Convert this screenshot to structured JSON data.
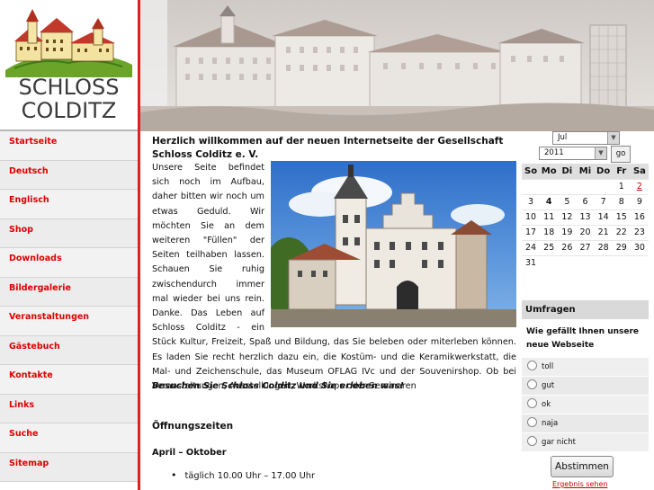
{
  "logo": {
    "line1": "SCHLOSS",
    "line2": "COLDITZ"
  },
  "nav": {
    "items": [
      {
        "label": "Startseite"
      },
      {
        "label": "Deutsch"
      },
      {
        "label": "Englisch"
      },
      {
        "label": "Shop"
      },
      {
        "label": "Downloads"
      },
      {
        "label": "Bildergalerie"
      },
      {
        "label": "Veranstaltungen"
      },
      {
        "label": "Gästebuch"
      },
      {
        "label": "Kontakte"
      },
      {
        "label": "Links"
      },
      {
        "label": "Suche"
      },
      {
        "label": "Sitemap"
      }
    ]
  },
  "main": {
    "welcome": "Herzlich willkommen auf der neuen Internetseite der Gesellschaft Schloss Colditz e. V.",
    "intro": "Unsere Seite befindet sich noch im Aufbau, daher bitten wir noch um etwas Geduld. Wir möchten Sie an dem weiteren \"Füllen\" der Seiten teilhaben lassen. Schauen Sie ruhig zwischendurch immer mal wieder bei uns rein. Danke. Das Leben auf Schloss Colditz - ein Stück Kultur, Freizeit, Spaß und Bildung, das Sie beleben oder miterleben können. Es laden Sie recht herzlich dazu ein, die Kostüm- und die Keramikwerkstatt, die Mal- und Zeichenschule, das Museum OFLAG IVc und der Souvenirshop. Ob bei Veranstaltungen, Ausstellungen, Workshops oder Seminaren",
    "tagline": "Besuchen Sie Schloss Colditz und Sie erleben was!",
    "hours_title": "Öffnungszeiten",
    "season": "April – Oktober",
    "hours": [
      "täglich 10.00 Uhr – 17.00 Uhr"
    ]
  },
  "calendar": {
    "month": "Jul",
    "year": "2011",
    "go_label": "go",
    "weekdays": [
      "So",
      "Mo",
      "Di",
      "Mi",
      "Do",
      "Fr",
      "Sa"
    ],
    "weeks": [
      [
        "",
        "",
        "",
        "",
        "",
        "1",
        "2"
      ],
      [
        "3",
        "4",
        "5",
        "6",
        "7",
        "8",
        "9"
      ],
      [
        "10",
        "11",
        "12",
        "13",
        "14",
        "15",
        "16"
      ],
      [
        "17",
        "18",
        "19",
        "20",
        "21",
        "22",
        "23"
      ],
      [
        "24",
        "25",
        "26",
        "27",
        "28",
        "29",
        "30"
      ],
      [
        "31",
        "",
        "",
        "",
        "",
        "",
        ""
      ]
    ],
    "today": "4",
    "linked_day": "2"
  },
  "poll": {
    "title": "Umfragen",
    "question": "Wie gefällt Ihnen unsere neue Webseite",
    "options": [
      "toll",
      "gut",
      "ok",
      "naja",
      "gar nicht"
    ],
    "vote_label": "Abstimmen",
    "results_label": "Ergebnis sehen"
  },
  "colors": {
    "accent_red": "#e00000",
    "nav_bg": "#ececec",
    "header_bg": "#dcd9d6"
  }
}
